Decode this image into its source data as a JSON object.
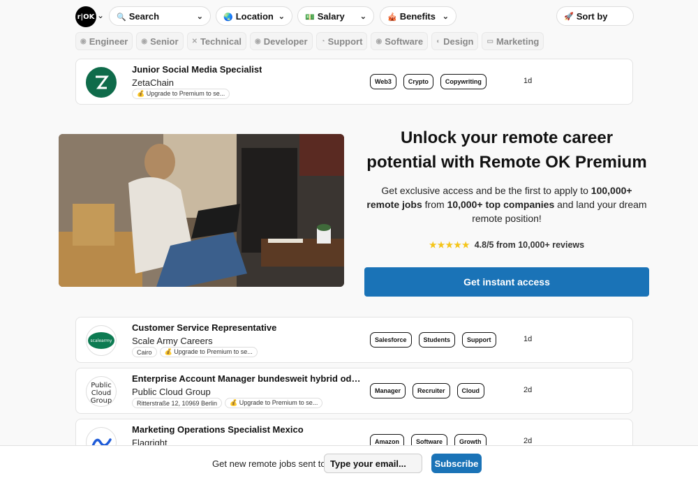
{
  "header": {
    "logo_text": "r|OK",
    "filters": [
      {
        "label": "Search",
        "icon": "magnifier-icon"
      },
      {
        "label": "Location",
        "icon": "globe-icon"
      },
      {
        "label": "Salary",
        "icon": "money-icon"
      },
      {
        "label": "Benefits",
        "icon": "gift-icon"
      }
    ],
    "sort_label": "Sort by"
  },
  "tags": [
    "Engineer",
    "Senior",
    "Technical",
    "Developer",
    "Support",
    "Software",
    "Design",
    "Marketing"
  ],
  "jobs": [
    {
      "title": "Junior Social Media Specialist",
      "company": "ZetaChain",
      "metas": [
        "💰 Upgrade to Premium to se..."
      ],
      "skills": [
        "Web3",
        "Crypto",
        "Copywriting"
      ],
      "age": "1d",
      "logo_color": "#0f6b4a"
    },
    {
      "title": "Customer Service Representative",
      "company": "Scale Army Careers",
      "metas": [
        "Cairo",
        "💰 Upgrade to Premium to se..."
      ],
      "skills": [
        "Salesforce",
        "Students",
        "Support"
      ],
      "age": "1d",
      "logo_color": "#0d7b52"
    },
    {
      "title": "Enterprise Account Manager bundesweit hybrid oder...",
      "company": "Public Cloud Group",
      "metas": [
        "Ritterstraße 12, 10969 Berlin",
        "💰 Upgrade to Premium to se..."
      ],
      "skills": [
        "Manager",
        "Recruiter",
        "Cloud"
      ],
      "age": "2d",
      "logo_color": "#222222"
    },
    {
      "title": "Marketing Operations Specialist Mexico",
      "company": "Flagright",
      "metas": [],
      "skills": [
        "Amazon",
        "Software",
        "Growth"
      ],
      "age": "2d",
      "logo_color": "#1e5bd8"
    }
  ],
  "promo": {
    "title": "Unlock your remote career potential with Remote OK Premium",
    "desc_1": "Get exclusive access and be the first to apply to",
    "desc_b1": "100,000+ remote jobs",
    "desc_2": "from",
    "desc_b2": "10,000+ top companies",
    "desc_3": "and land your dream remote position!",
    "rating_stars": "★★★★★",
    "rating_text": "4.8/5 from 10,000+ reviews",
    "cta": "Get instant access"
  },
  "newsletter": {
    "text": "Get new remote jobs sent to",
    "placeholder": "Type your email...",
    "button": "Subscribe"
  }
}
